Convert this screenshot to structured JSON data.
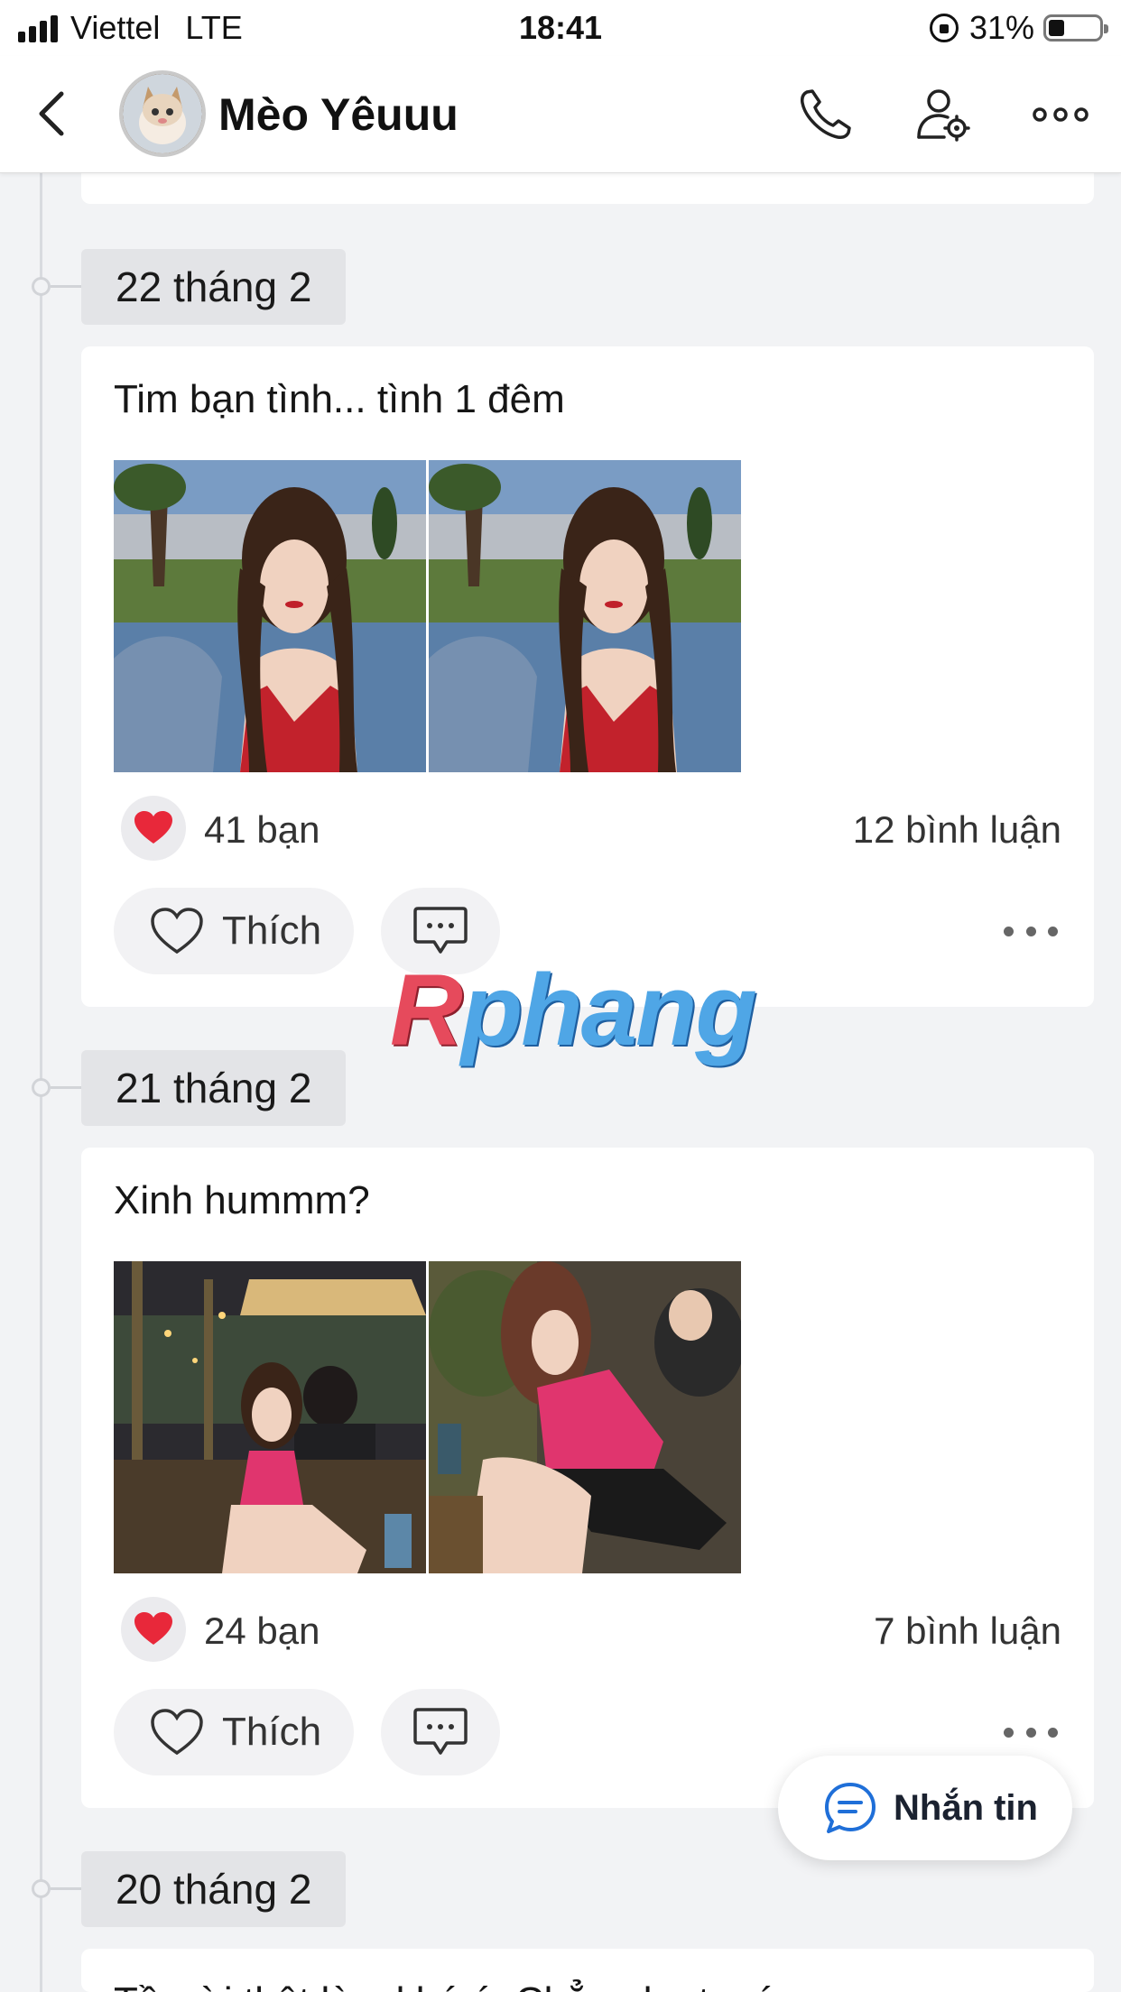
{
  "status_bar": {
    "carrier": "Viettel",
    "network": "LTE",
    "time": "18:41",
    "battery_percent": "31%",
    "battery_level": 0.31
  },
  "header": {
    "title": "Mèo Yêuuu",
    "icons": [
      "back-chevron",
      "phone-icon",
      "user-settings-icon",
      "more-icon"
    ]
  },
  "posts": [
    {
      "date": "22 tháng 2",
      "text": "Tim bạn tình... tình 1 đêm",
      "reaction_count": "41 bạn",
      "comment_count": "12 bình luận",
      "like_label": "Thích"
    },
    {
      "date": "21 tháng 2",
      "text": "Xinh hummm?",
      "reaction_count": "24 bạn",
      "comment_count": "7 bình luận",
      "like_label": "Thích"
    },
    {
      "date": "20 tháng 2",
      "text": "Tồ    ười thật làm khó    ó. Chẳng ha t ọ  ó"
    }
  ],
  "watermark": {
    "first": "R",
    "rest": "phang"
  },
  "fab": {
    "label": "Nhắn tin"
  },
  "colors": {
    "accent": "#1f6fd8",
    "heart": "#e8283a",
    "background": "#f2f3f5"
  }
}
